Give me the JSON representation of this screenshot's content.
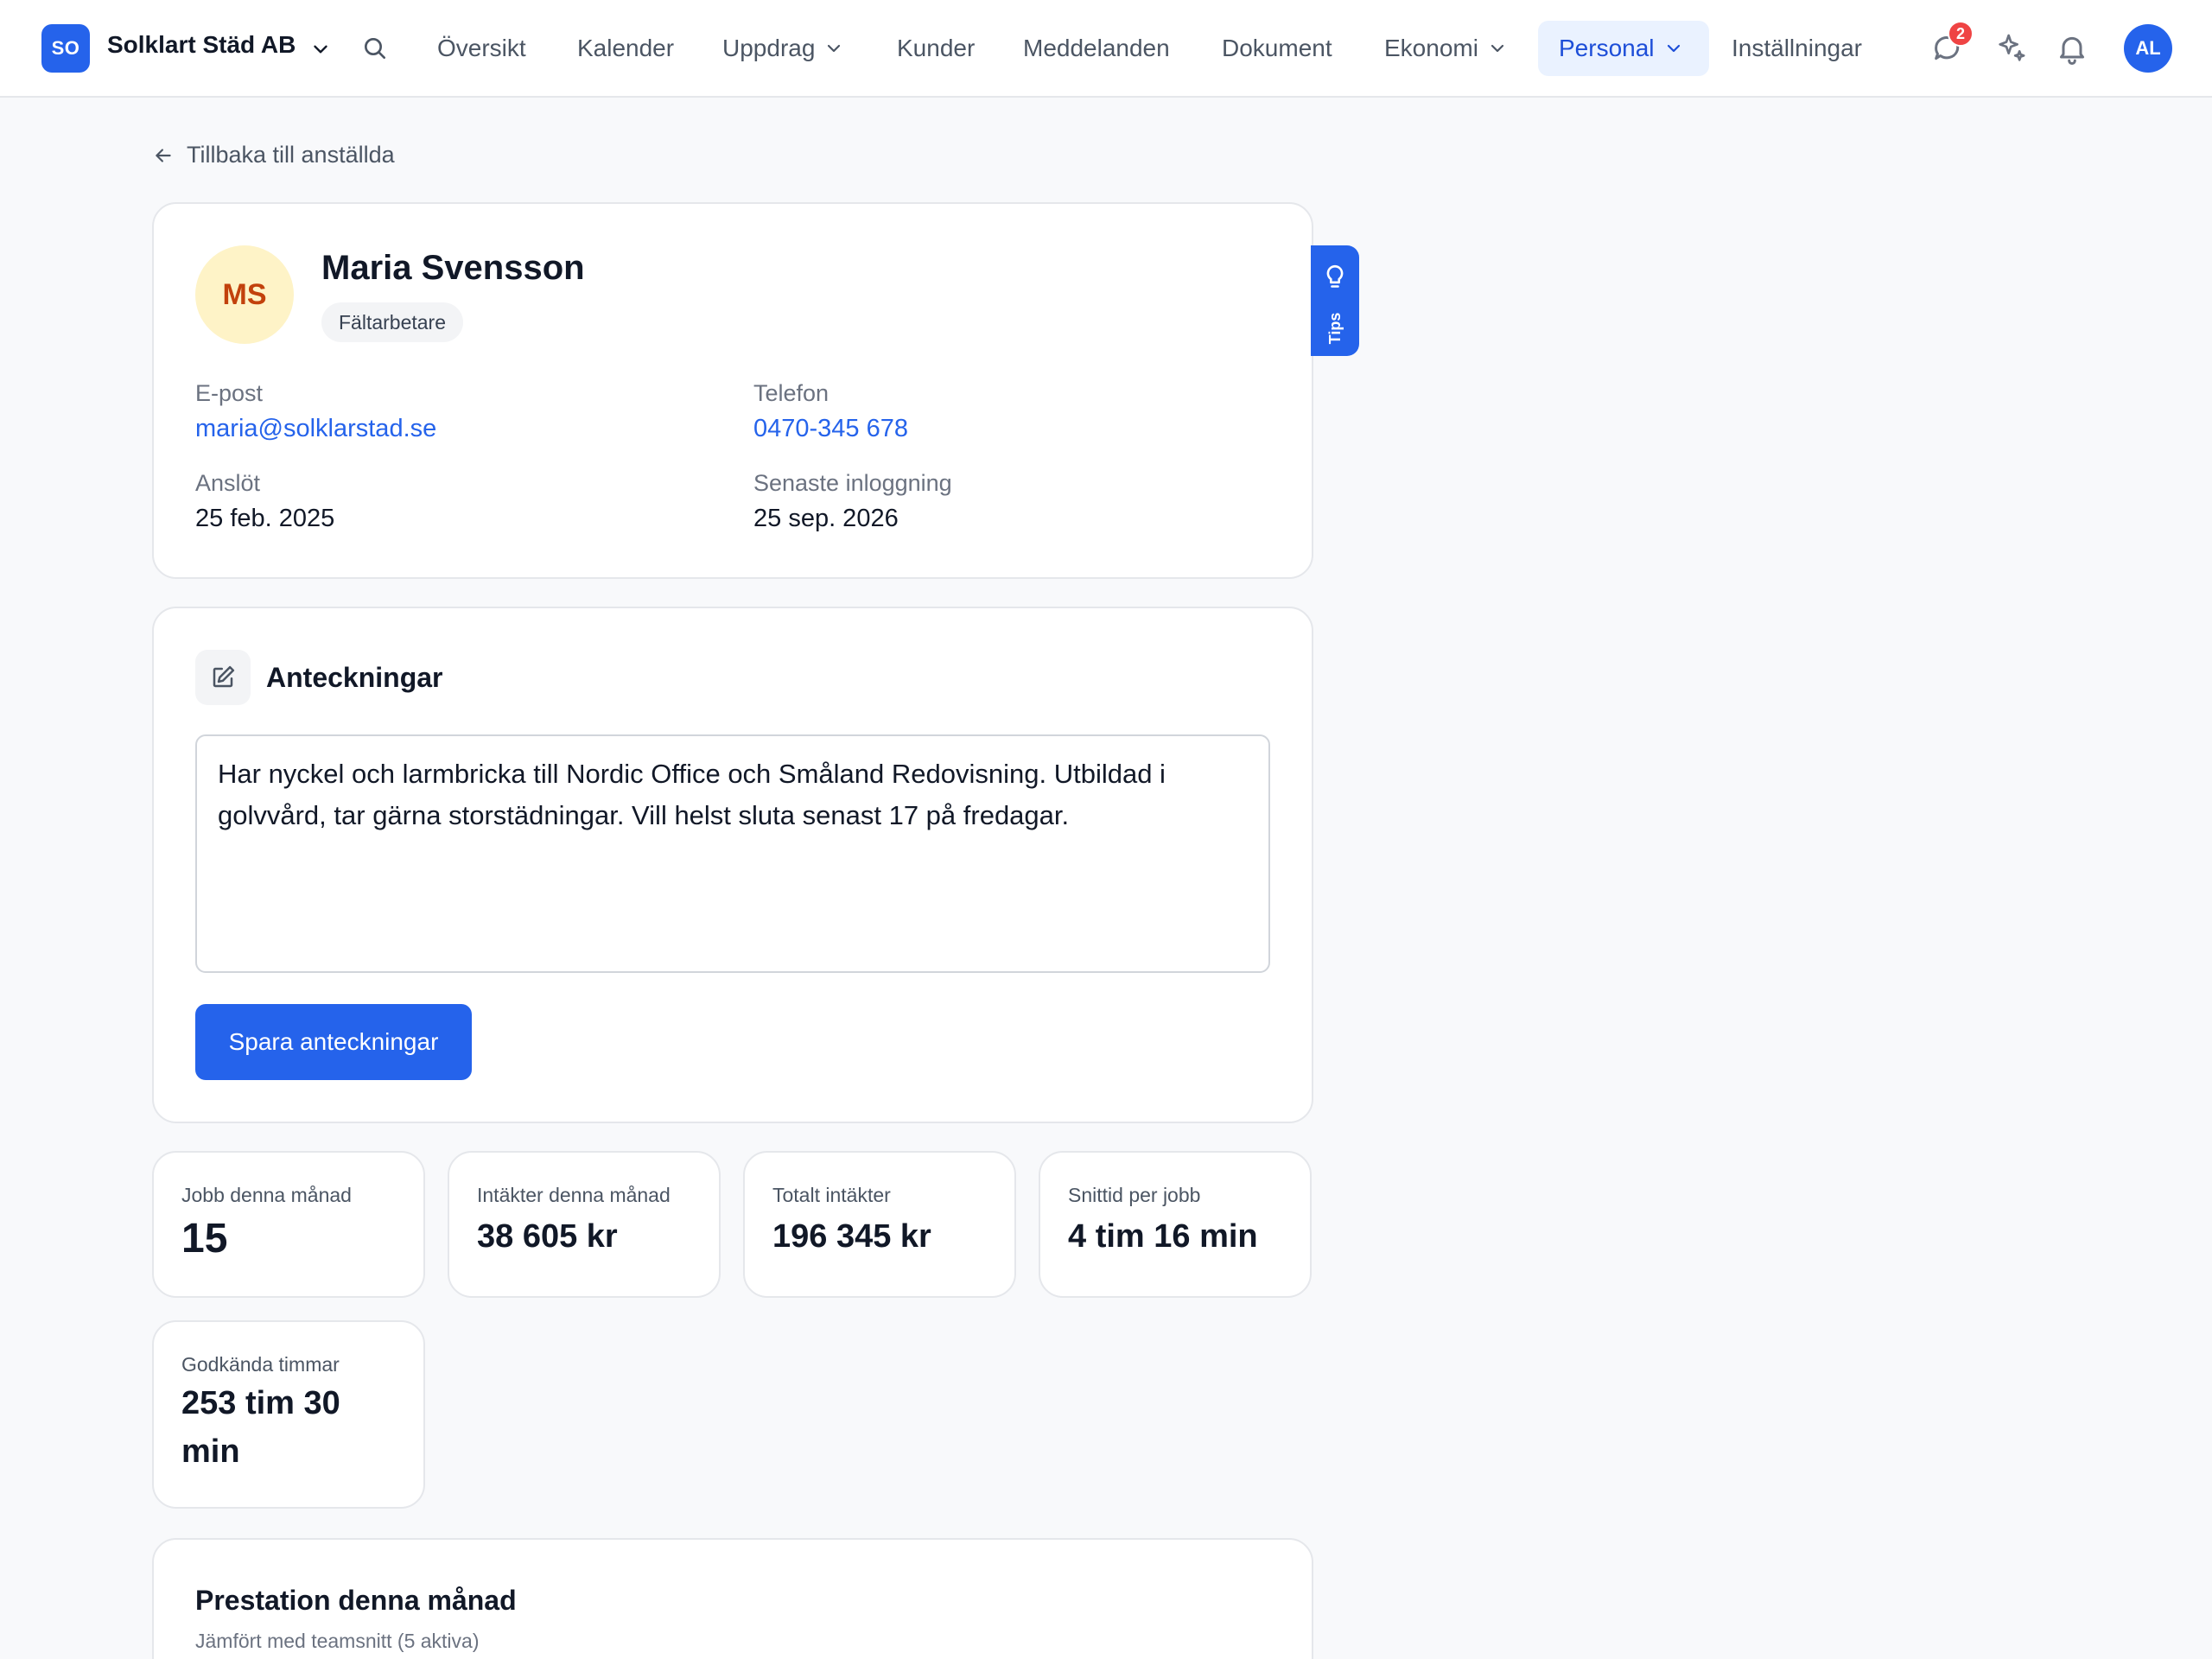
{
  "nav": {
    "brand_initials": "SO",
    "company": "Solklart Städ AB",
    "items": [
      {
        "label": "Översikt"
      },
      {
        "label": "Kalender"
      },
      {
        "label": "Uppdrag"
      },
      {
        "label": "Kunder"
      },
      {
        "label": "Meddelanden"
      },
      {
        "label": "Dokument"
      },
      {
        "label": "Ekonomi"
      },
      {
        "label": "Personal"
      },
      {
        "label": "Inställningar"
      }
    ],
    "message_badge": "2",
    "user_initials": "AL",
    "accent_color": "#2563eb"
  },
  "back_link": "Tillbaka till anställda",
  "profile": {
    "initials": "MS",
    "name": "Maria Svensson",
    "role": "Fältarbetare",
    "email_label": "E-post",
    "email": "maria@solklarstad.se",
    "phone_label": "Telefon",
    "phone": "0470-345 678",
    "joined_label": "Anslöt",
    "joined": "25 feb. 2025",
    "last_login_label": "Senaste inloggning",
    "last_login": "25 sep. 2026"
  },
  "tips_label": "Tips",
  "notes": {
    "title": "Anteckningar",
    "text": "Har nyckel och larmbricka till Nordic Office och Småland Redovisning. Utbildad i golvvård, tar gärna storstädningar. Vill helst sluta senast 17 på fredagar.",
    "save_label": "Spara anteckningar"
  },
  "stats": [
    {
      "label": "Jobb denna månad",
      "value": "15"
    },
    {
      "label": "Intäkter denna månad",
      "value": "38 605 kr"
    },
    {
      "label": "Totalt intäkter",
      "value": "196 345 kr"
    },
    {
      "label": "Snittid per jobb",
      "value": "4 tim 16 min"
    },
    {
      "label": "Godkända timmar",
      "value": "253 tim 30 min"
    }
  ],
  "performance": {
    "title": "Prestation denna månad",
    "subtitle": "Jämfört med teamsnitt (5 aktiva)"
  }
}
